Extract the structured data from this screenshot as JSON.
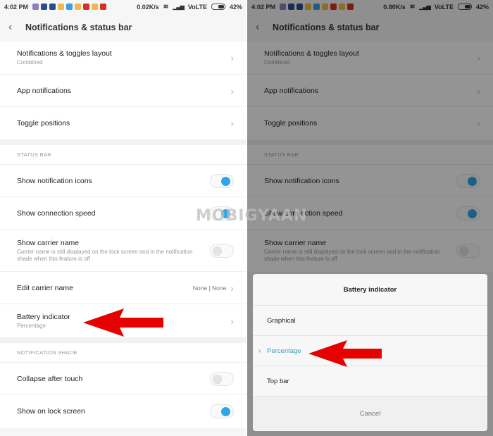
{
  "status_bar_left": {
    "time": "4:02 PM",
    "speed": "0.02K/s",
    "network": "VoLTE",
    "battery": "42%"
  },
  "status_bar_right": {
    "time": "4:02 PM",
    "speed": "0.80K/s",
    "network": "VoLTE",
    "battery": "42%"
  },
  "status_icons": [
    {
      "name": "purple-app-icon",
      "color": "#8e7cc3"
    },
    {
      "name": "image-app-icon",
      "color": "#2b4c8c"
    },
    {
      "name": "image-app-icon",
      "color": "#2b4c8c"
    },
    {
      "name": "yellow-app-icon",
      "color": "#f1b94a"
    },
    {
      "name": "upload-icon",
      "color": "#3d9be0"
    },
    {
      "name": "yellow-app-icon",
      "color": "#f1b94a"
    },
    {
      "name": "youtube-icon",
      "color": "#d93025"
    },
    {
      "name": "yellow-app-icon",
      "color": "#f1b94a"
    },
    {
      "name": "youtube-icon",
      "color": "#d93025"
    }
  ],
  "header": {
    "title": "Notifications & status bar",
    "back_icon": "‹"
  },
  "top_items": [
    {
      "title": "Notifications & toggles layout",
      "subtitle": "Combined"
    },
    {
      "title": "App notifications"
    },
    {
      "title": "Toggle positions"
    }
  ],
  "status_bar_section": {
    "heading": "STATUS BAR",
    "items": [
      {
        "title": "Show notification icons",
        "toggle": true
      },
      {
        "title": "Show connection speed",
        "toggle": true
      },
      {
        "title": "Show carrier name",
        "subtitle": "Carrier name is still displayed on the lock screen and in the notification shade when this feature is off",
        "toggle": false
      },
      {
        "title": "Edit carrier name",
        "value": "None | None"
      },
      {
        "title": "Battery indicator",
        "subtitle": "Percentage"
      }
    ]
  },
  "notification_shade_section": {
    "heading": "NOTIFICATION SHADE",
    "items": [
      {
        "title": "Collapse after touch",
        "toggle": false
      },
      {
        "title": "Show on lock screen",
        "toggle": true
      }
    ]
  },
  "dialog": {
    "title": "Battery indicator",
    "options": [
      "Graphical",
      "Percentage",
      "Top bar"
    ],
    "selected": "Percentage",
    "cancel": "Cancel"
  },
  "watermark": "MOBIGYAAN",
  "colors": {
    "accent": "#2fa6ea",
    "selected": "#3aa0bf",
    "arrow": "#e60000"
  }
}
